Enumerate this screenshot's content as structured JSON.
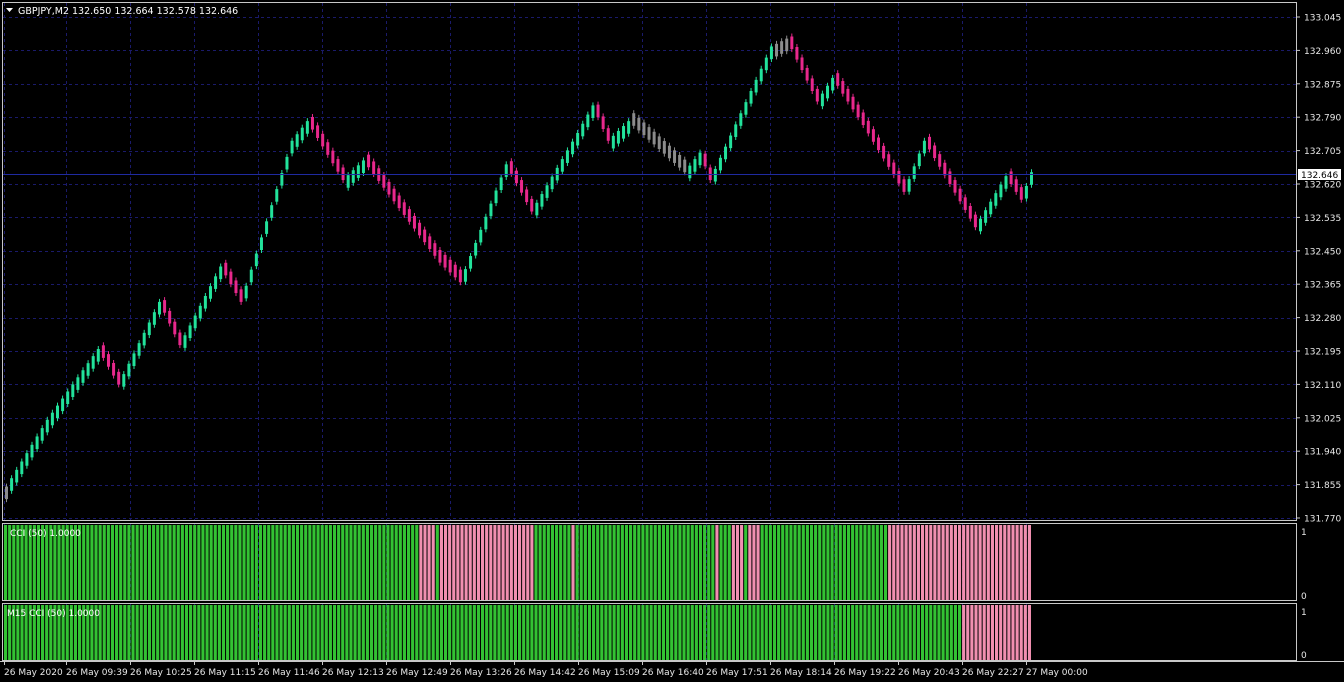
{
  "symbol_header": "GBPJPY,M2  132.650 132.664 132.578 132.646",
  "current_price": "132.646",
  "price_axis": [
    "133.045",
    "132.960",
    "132.875",
    "132.790",
    "132.705",
    "132.620",
    "132.535",
    "132.450",
    "132.365",
    "132.280",
    "132.195",
    "132.110",
    "132.025",
    "131.940",
    "131.855",
    "131.770"
  ],
  "time_axis": [
    "26 May 2020",
    "26 May 09:39",
    "26 May 10:25",
    "26 May 11:15",
    "26 May 11:46",
    "26 May 12:13",
    "26 May 12:49",
    "26 May 13:26",
    "26 May 14:42",
    "26 May 15:09",
    "26 May 16:40",
    "26 May 17:51",
    "26 May 18:14",
    "26 May 19:22",
    "26 May 20:43",
    "26 May 22:27",
    "27 May 00:00"
  ],
  "indicator1": {
    "label": "CCI (50) 1.0000",
    "scale_top": "1",
    "scale_bottom": "0"
  },
  "indicator2": {
    "label": "M15 CCI (50) 1.0000",
    "scale_top": "1",
    "scale_bottom": "0"
  },
  "colors": {
    "background": "#000000",
    "bull": "#22e29b",
    "bear": "#e8288c",
    "neutral": "#8c8c8c",
    "hist_bull": "#33c233",
    "hist_bear": "#f08fb0",
    "current_line": "#1f2aa0"
  },
  "chart_data": {
    "type": "renko",
    "ylim": [
      131.75,
      133.07
    ],
    "anchors": [
      [
        0,
        131.85
      ],
      [
        8,
        132.02
      ],
      [
        18,
        132.2
      ],
      [
        22,
        132.11
      ],
      [
        30,
        132.32
      ],
      [
        34,
        132.21
      ],
      [
        42,
        132.41
      ],
      [
        46,
        132.32
      ],
      [
        56,
        132.73
      ],
      [
        59,
        132.78
      ],
      [
        66,
        132.63
      ],
      [
        70,
        132.68
      ],
      [
        85,
        132.42
      ],
      [
        89,
        132.37
      ],
      [
        98,
        132.67
      ],
      [
        103,
        132.55
      ],
      [
        112,
        132.75
      ],
      [
        115,
        132.82
      ],
      [
        118,
        132.73
      ],
      [
        122,
        132.78
      ],
      [
        133,
        132.65
      ],
      [
        136,
        132.7
      ],
      [
        138,
        132.63
      ],
      [
        150,
        132.97
      ],
      [
        153,
        132.99
      ],
      [
        159,
        132.83
      ],
      [
        162,
        132.89
      ],
      [
        168,
        132.77
      ],
      [
        176,
        132.6
      ],
      [
        180,
        132.73
      ],
      [
        190,
        132.51
      ],
      [
        196,
        132.64
      ],
      [
        199,
        132.58
      ],
      [
        201,
        132.65
      ]
    ],
    "cci_h1_pattern": [
      {
        "from": 0,
        "to": 0.4047,
        "state": "bull"
      },
      {
        "from": 0.4047,
        "to": 0.4188,
        "state": "bear"
      },
      {
        "from": 0.4188,
        "to": 0.424,
        "state": "bull"
      },
      {
        "from": 0.424,
        "to": 0.5165,
        "state": "bear"
      },
      {
        "from": 0.5165,
        "to": 0.553,
        "state": "bull"
      },
      {
        "from": 0.553,
        "to": 0.557,
        "state": "bear"
      },
      {
        "from": 0.557,
        "to": 0.694,
        "state": "bull"
      },
      {
        "from": 0.694,
        "to": 0.698,
        "state": "bear"
      },
      {
        "from": 0.698,
        "to": 0.709,
        "state": "bull"
      },
      {
        "from": 0.709,
        "to": 0.72,
        "state": "bear"
      },
      {
        "from": 0.72,
        "to": 0.726,
        "state": "bull"
      },
      {
        "from": 0.726,
        "to": 0.735,
        "state": "bear"
      },
      {
        "from": 0.735,
        "to": 0.86,
        "state": "bull"
      },
      {
        "from": 0.86,
        "to": 0.875,
        "state": "bear"
      },
      {
        "from": 0.875,
        "to": 1,
        "state": "bear"
      }
    ],
    "cci_m15_pattern": [
      {
        "from": 0,
        "to": 0.9325,
        "state": "bull"
      },
      {
        "from": 0.9325,
        "to": 1,
        "state": "bear"
      }
    ]
  }
}
